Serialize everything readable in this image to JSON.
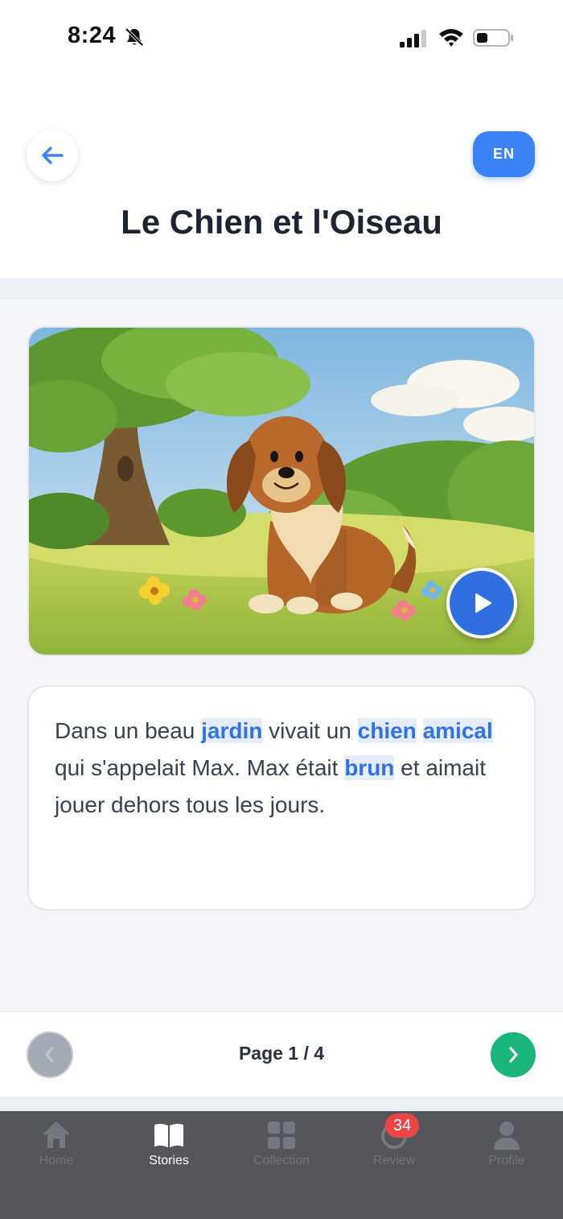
{
  "status_bar": {
    "time": "8:24"
  },
  "header": {
    "language_toggle": "EN",
    "story_title": "Le Chien et l'Oiseau"
  },
  "story": {
    "segments": [
      {
        "text": "Dans un beau ",
        "vocab": false
      },
      {
        "text": "jardin",
        "vocab": true
      },
      {
        "text": " vivait un ",
        "vocab": false
      },
      {
        "text": "chien",
        "vocab": true
      },
      {
        "text": " ",
        "vocab": false
      },
      {
        "text": "amical",
        "vocab": true
      },
      {
        "text": " qui s'appelait Max. Max était ",
        "vocab": false
      },
      {
        "text": "brun",
        "vocab": true
      },
      {
        "text": " et aimait jouer dehors tous les jours.",
        "vocab": false
      }
    ]
  },
  "pager": {
    "page_label": "Page 1 / 4"
  },
  "tabbar": {
    "tabs": [
      {
        "label": "Home",
        "icon": "home-icon",
        "active": false
      },
      {
        "label": "Stories",
        "icon": "book-icon",
        "active": true
      },
      {
        "label": "Collection",
        "icon": "grid-icon",
        "active": false
      },
      {
        "label": "Review",
        "icon": "review-ring-icon",
        "active": false
      },
      {
        "label": "Profile",
        "icon": "person-icon",
        "active": false
      }
    ],
    "review_badge": "34"
  },
  "colors": {
    "accent": "#3b82f6",
    "next": "#19b57a",
    "badge": "#ef4444",
    "tabbar": "#545659"
  }
}
